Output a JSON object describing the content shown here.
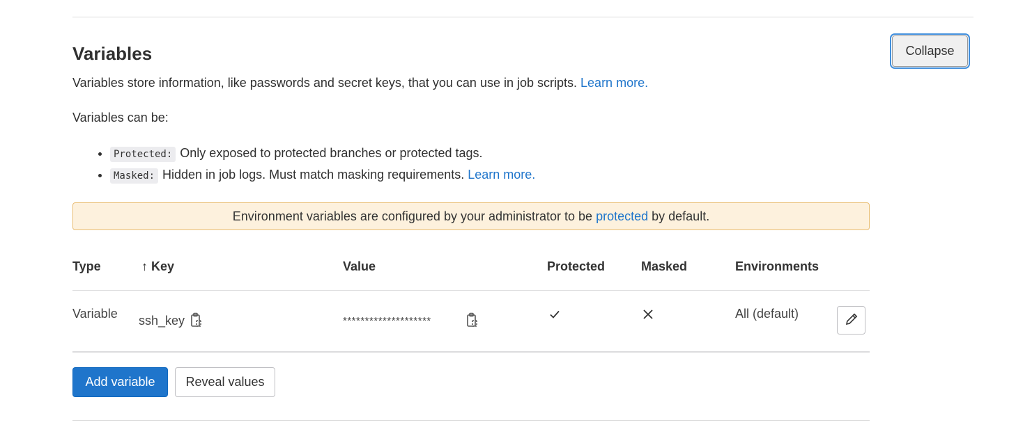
{
  "section": {
    "title": "Variables",
    "collapse_label": "Collapse",
    "description": "Variables store information, like passwords and secret keys, that you can use in job scripts.",
    "learn_more": "Learn more.",
    "can_be": "Variables can be:",
    "bullets": [
      {
        "tag": "Protected:",
        "text": "Only exposed to protected branches or protected tags."
      },
      {
        "tag": "Masked:",
        "text": "Hidden in job logs. Must match masking requirements.",
        "link": "Learn more."
      }
    ]
  },
  "alert": {
    "prefix": "Environment variables are configured by your administrator to be",
    "link": "protected",
    "suffix": "by default."
  },
  "table": {
    "headers": {
      "type": "Type",
      "sort_arrow": "↑",
      "key": "Key",
      "value": "Value",
      "protected": "Protected",
      "masked": "Masked",
      "environments": "Environments"
    },
    "rows": [
      {
        "type": "Variable",
        "key": "ssh_key",
        "value": "********************",
        "protected": true,
        "protected_icon": "check-icon",
        "masked": false,
        "masked_icon": "close-icon",
        "environments": "All (default)"
      }
    ]
  },
  "actions": {
    "add_label": "Add variable",
    "reveal_label": "Reveal values"
  },
  "colors": {
    "link": "#1f75cb",
    "primary": "#1f75cb",
    "alert_bg": "#fdf1dd",
    "alert_border": "#e9be74"
  }
}
